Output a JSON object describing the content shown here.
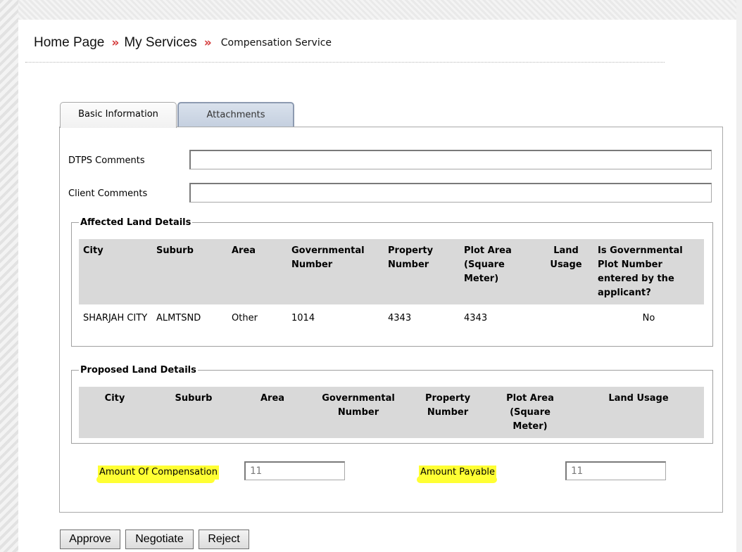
{
  "breadcrumb": {
    "items": [
      "Home Page",
      "My Services"
    ],
    "separator": "»",
    "current": "Compensation Service"
  },
  "tabs": [
    {
      "label": "Basic Information",
      "active": true
    },
    {
      "label": "Attachments",
      "active": false
    }
  ],
  "form": {
    "dtps_comments": {
      "label": "DTPS Comments",
      "value": ""
    },
    "client_comments": {
      "label": "Client Comments",
      "value": ""
    }
  },
  "affected_land": {
    "legend": "Affected Land Details",
    "headers": [
      "City",
      "Suburb",
      "Area",
      "Governmental Number",
      "Property Number",
      "Plot Area (Square Meter)",
      "Land Usage",
      "Is Governmental Plot Number entered by the applicant?"
    ],
    "rows": [
      [
        "SHARJAH CITY",
        "ALMTSND",
        "Other",
        "1014",
        "4343",
        "4343",
        "",
        "No"
      ]
    ]
  },
  "proposed_land": {
    "legend": "Proposed Land Details",
    "headers": [
      "City",
      "Suburb",
      "Area",
      "Governmental Number",
      "Property Number",
      "Plot Area (Square Meter)",
      "Land Usage"
    ],
    "rows": []
  },
  "amounts": {
    "compensation": {
      "label": "Amount Of Compensation",
      "value": "11"
    },
    "payable": {
      "label": "Amount Payable",
      "value": "11"
    }
  },
  "buttons": {
    "approve": "Approve",
    "negotiate": "Negotiate",
    "reject": "Reject"
  },
  "colors": {
    "breadcrumb_separator": "#d43a3a",
    "highlight": "#ffff33",
    "table_header": "#d9d9d9"
  }
}
